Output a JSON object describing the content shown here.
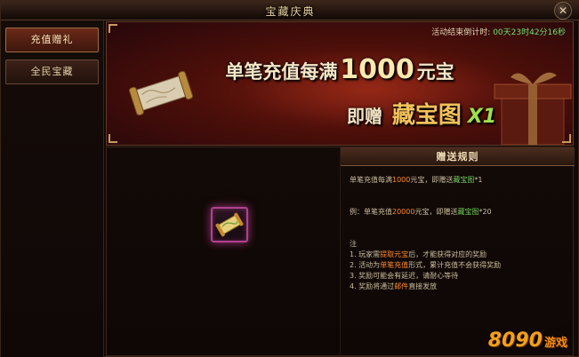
{
  "window": {
    "title": "宝藏庆典",
    "close_glyph": "✕"
  },
  "sidebar": {
    "items": [
      {
        "label": "充值赠礼",
        "active": true
      },
      {
        "label": "全民宝藏",
        "active": false
      }
    ]
  },
  "banner": {
    "countdown_label": "活动结束倒计时:",
    "countdown_value": "00天23时42分16秒",
    "headline_prefix": "单笔充值每满",
    "headline_amount": "1000",
    "headline_unit": "元宝",
    "subline_prefix": "即赠",
    "subline_item": "藏宝图",
    "subline_qty": "X1"
  },
  "rules": {
    "header": "赠送规则",
    "line1": {
      "a": "单笔充值每满",
      "b": "1000",
      "c": "元宝，即赠送",
      "d": "藏宝图",
      "e": "*1"
    },
    "line2": {
      "a": "例：单笔充值",
      "b": "20000",
      "c": "元宝，即赠送",
      "d": "藏宝图",
      "e": "*20"
    },
    "note_title": "注",
    "note1": {
      "a": "1. 玩家需",
      "b": "提取元宝",
      "c": "后，才能获得对应的奖励"
    },
    "note2": {
      "a": "2. 活动为",
      "b": "单笔充值",
      "c": "形式，累计充值不会获得奖励"
    },
    "note3": "3. 奖励可能会有延迟，请耐心等待",
    "note4": {
      "a": "4. 奖励将通过",
      "b": "邮件",
      "c": "直接发放"
    }
  },
  "reward_item": {
    "icon": "treasure-map-scroll",
    "rarity_color": "#b04290"
  },
  "watermark": {
    "number": "8090",
    "text": "游戏"
  },
  "colors": {
    "highlight_orange": "#ff8a2a",
    "highlight_green": "#6fd05a",
    "countdown_green": "#6ee06e",
    "item_gold": "#f4c25a"
  }
}
